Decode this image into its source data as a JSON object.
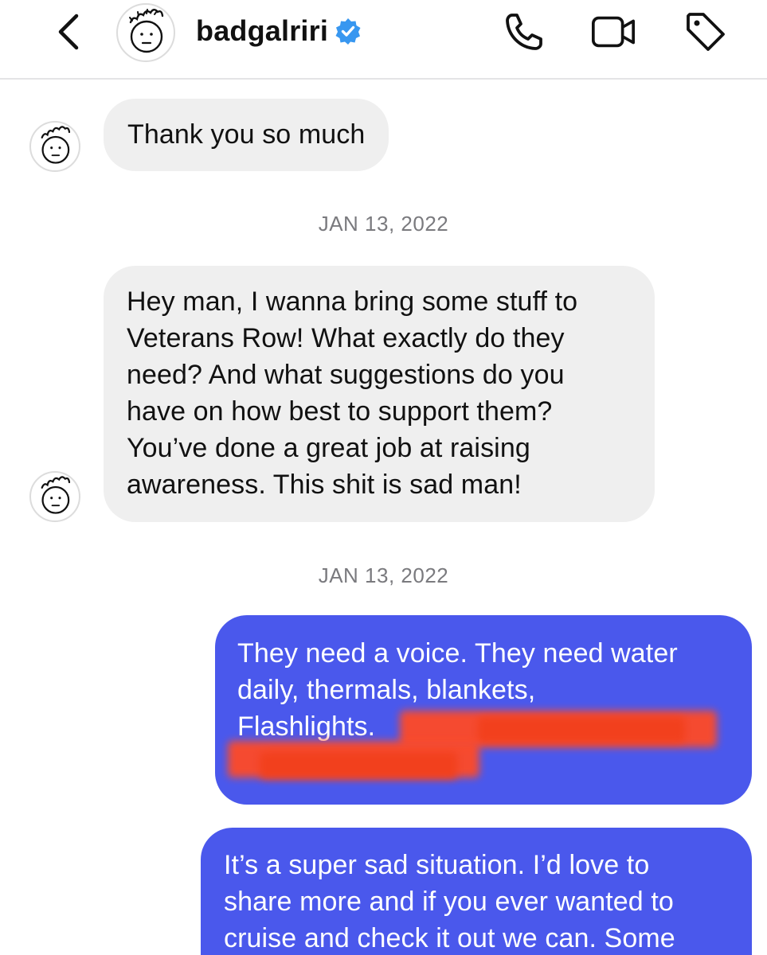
{
  "header": {
    "username": "badgalriri",
    "back_icon": "chevron-left-icon",
    "verified_icon": "verified-badge-icon",
    "actions": [
      {
        "name": "audio-call-button",
        "icon": "phone-icon"
      },
      {
        "name": "video-call-button",
        "icon": "video-camera-icon"
      },
      {
        "name": "tag-button",
        "icon": "tag-icon"
      }
    ]
  },
  "colors": {
    "outgoing_bubble": "#4a58ec",
    "incoming_bubble": "#efefef",
    "verified_badge": "#3897f0",
    "redaction": "#ff4a26"
  },
  "conversation": {
    "message_1": {
      "sender": "them",
      "lines": [
        "Thank you so much"
      ]
    },
    "timestamp_1": "JAN 13, 2022",
    "message_2": {
      "sender": "them",
      "lines": [
        "Hey man, I wanna bring some stuff to",
        "Veterans Row! What exactly do they",
        "need? And what suggestions do you",
        "have on how best to support them?",
        "You’ve done a great job at raising",
        "awareness. This shit is sad man!"
      ]
    },
    "timestamp_2": "JAN 13, 2022",
    "message_3": {
      "sender": "me",
      "lines": [
        "They need a voice. They need water",
        "daily, thermals, blankets,",
        "Flashlights."
      ]
    },
    "message_4": {
      "sender": "me",
      "lines": [
        "It’s a super sad situation. I’d love to",
        "share more and if you ever wanted to",
        "cruise and check it out we can. Some"
      ]
    }
  }
}
